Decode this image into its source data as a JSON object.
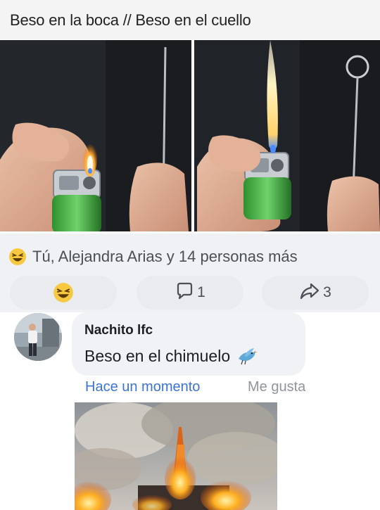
{
  "caption": {
    "text": "Beso en la boca // Beso en el cuello"
  },
  "reactions": {
    "summary_text": "Tú, Alejandra Arias y 14 personas más",
    "summary_icon": "laughing-emoji-icon",
    "comment_count": "1",
    "share_count": "3"
  },
  "comment": {
    "author": "Nachito lfc",
    "text": "Beso en el chimuelo",
    "timestamp": "Hace un momento",
    "like_label": "Me gusta"
  },
  "colors": {
    "link_blue": "#3b73d6",
    "muted_gray": "#90949c",
    "emoji_yellow": "#f7c940"
  }
}
